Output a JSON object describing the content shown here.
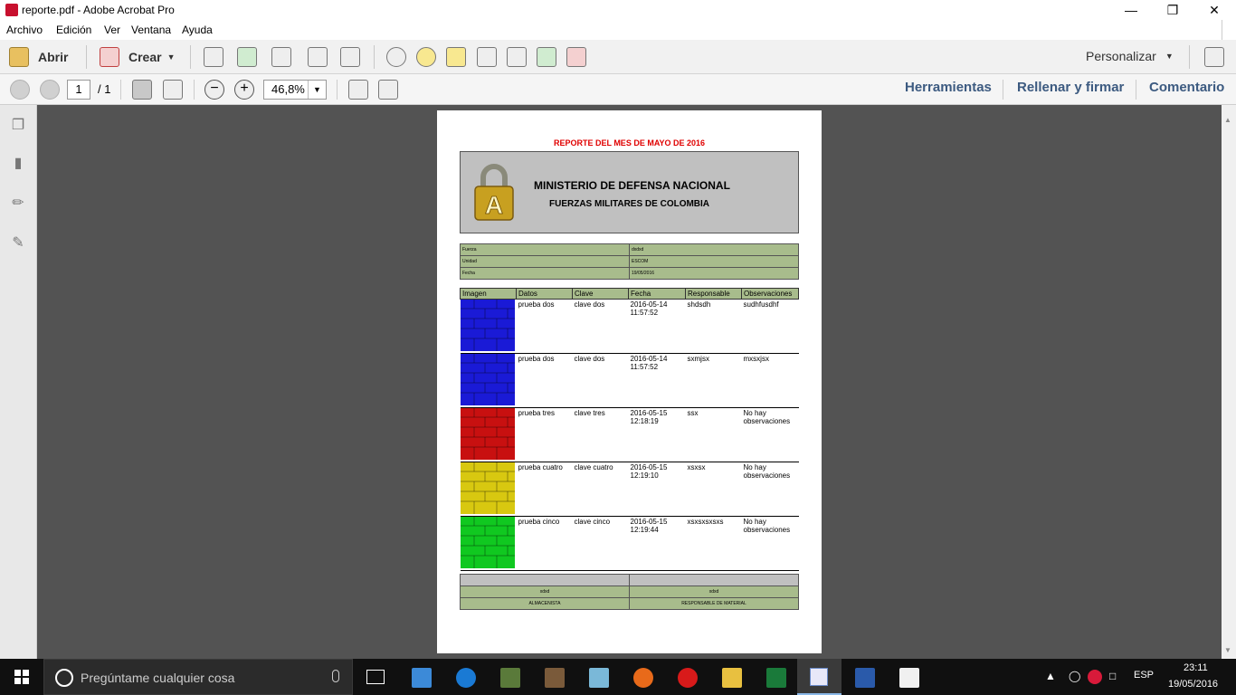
{
  "window": {
    "title": "reporte.pdf - Adobe Acrobat Pro"
  },
  "menu": [
    "Archivo",
    "Edición",
    "Ver",
    "Ventana",
    "Ayuda"
  ],
  "toolbar": {
    "open_label": "Abrir",
    "create_label": "Crear",
    "customize_label": "Personalizar"
  },
  "nav": {
    "page": "1",
    "total": "/ 1",
    "zoom": "46,8%"
  },
  "panels": [
    "Herramientas",
    "Rellenar y firmar",
    "Comentario"
  ],
  "report": {
    "title": "REPORTE DEL MES DE MAYO DE 2016",
    "org1": "MINISTERIO DE DEFENSA NACIONAL",
    "org2": "FUERZAS MILITARES DE COLOMBIA",
    "info": [
      {
        "label": "Fuerza",
        "value": "dxdxd"
      },
      {
        "label": "Unidad",
        "value": "ESCOM"
      },
      {
        "label": "Fecha",
        "value": "19/05/2016"
      }
    ],
    "columns": [
      "Imagen",
      "Datos",
      "Clave",
      "Fecha",
      "Responsable",
      "Observaciones"
    ],
    "rows": [
      {
        "color": "#1a1ad6",
        "datos": "prueba dos",
        "clave": "clave dos",
        "fecha": "2016-05-14 11:57:52",
        "responsable": "shdsdh",
        "obs": "sudhfusdhf"
      },
      {
        "color": "#1a1ad6",
        "datos": "prueba dos",
        "clave": "clave dos",
        "fecha": "2016-05-14 11:57:52",
        "responsable": "sxmjsx",
        "obs": "mxsxjsx"
      },
      {
        "color": "#c81010",
        "datos": "prueba tres",
        "clave": "clave tres",
        "fecha": "2016-05-15 12:18:19",
        "responsable": "ssx",
        "obs": "No hay observaciones"
      },
      {
        "color": "#d8c810",
        "datos": "prueba cuatro",
        "clave": "clave cuatro",
        "fecha": "2016-05-15 12:19:10",
        "responsable": "xsxsx",
        "obs": "No hay observaciones"
      },
      {
        "color": "#10c820",
        "datos": "prueba cinco",
        "clave": "clave cinco",
        "fecha": "2016-05-15 12:19:44",
        "responsable": "xsxsxsxsxs",
        "obs": "No hay observaciones"
      }
    ],
    "footer": {
      "left_val": "xdxd",
      "right_val": "xdxd",
      "left_role": "ALMACENISTA",
      "right_role": "RESPONSABLE DE MATERIAL"
    }
  },
  "taskbar": {
    "search_placeholder": "Pregúntame cualquier cosa",
    "lang": "ESP",
    "time": "23:11",
    "date": "19/05/2016"
  }
}
